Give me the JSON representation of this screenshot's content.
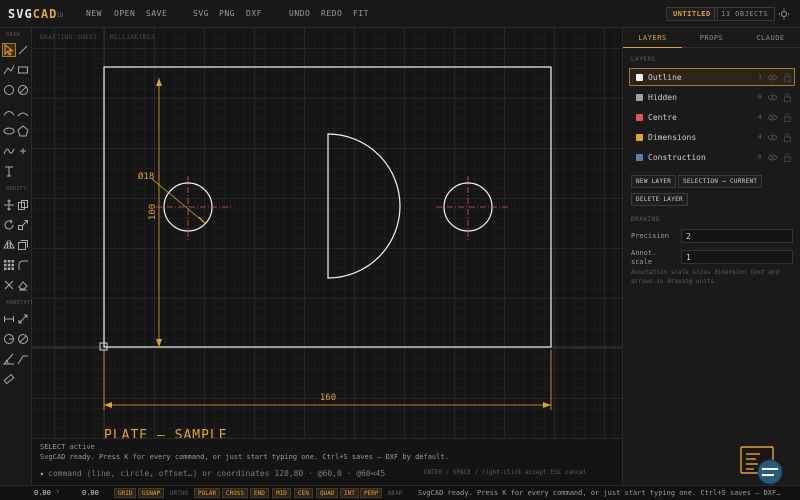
{
  "app": {
    "logo_main": "SVG",
    "logo_accent": "CAD",
    "logo_sub": "1D",
    "menu": [
      {
        "label": "NEW"
      },
      {
        "label": "OPEN"
      },
      {
        "label": "SAVE"
      },
      {
        "label": "SVG"
      },
      {
        "label": "PNG"
      },
      {
        "label": "DXF"
      },
      {
        "label": "UNDO"
      },
      {
        "label": "REDO"
      },
      {
        "label": "FIT"
      }
    ],
    "doc_name": "UNTITLED",
    "object_count": "13 OBJECTS"
  },
  "tools": {
    "sections": {
      "draw": "DRAW",
      "modify": "MODIFY",
      "annotate": "ANNOTATE"
    }
  },
  "canvas": {
    "label": "DRAFTING SHEET · MILLIMETRES",
    "dim_diameter": "Ø18",
    "dim_height": "100",
    "dim_width": "160",
    "title_text": "PLATE — SAMPLE"
  },
  "panel": {
    "tabs": [
      {
        "label": "LAYERS"
      },
      {
        "label": "PROPS"
      },
      {
        "label": "CLAUDE"
      }
    ],
    "layers_label": "LAYERS",
    "layers": [
      {
        "name": "Outline",
        "count": "3",
        "color": "#f2f2f2"
      },
      {
        "name": "Hidden",
        "count": "0",
        "color": "#9aa3ad"
      },
      {
        "name": "Centre",
        "count": "4",
        "color": "#e0575a"
      },
      {
        "name": "Dimensions",
        "count": "4",
        "color": "#e0a33a"
      },
      {
        "name": "Construction",
        "count": "0",
        "color": "#5e7f9e"
      }
    ],
    "buttons": {
      "new_layer": "NEW LAYER",
      "sel_current": "SELECTION → CURRENT",
      "delete_layer": "DELETE LAYER"
    },
    "drawing_label": "DRAWING",
    "precision_label": "Precision",
    "precision_value": "2",
    "annot_label_1": "Annot.",
    "annot_label_2": "scale",
    "annot_value": "1",
    "hint": "Annotation scale sizes dimension text and arrows in drawing units."
  },
  "console": {
    "line1": "SELECT active",
    "line2": "SvgCAD ready. Press K for every command, or just start typing one. Ctrl+S saves — DXF by default.",
    "prompt": "▸",
    "placeholder": "command (line, circle, offset…) or coordinates 120,80 · @60,0 · @60<45",
    "hints": "ENTER / SPACE / right-click accept   ESC cancel"
  },
  "status": {
    "x_value": "0.00",
    "x_label": "Y",
    "y_value": "0.00",
    "snaps": [
      {
        "label": "GRID",
        "on": true
      },
      {
        "label": "GSNAP",
        "on": true
      },
      {
        "label": "ORTHO",
        "on": false
      },
      {
        "label": "POLAR",
        "on": true
      },
      {
        "label": "CROSS",
        "on": true
      },
      {
        "label": "END",
        "on": true
      },
      {
        "label": "MID",
        "on": true
      },
      {
        "label": "CEN",
        "on": true
      },
      {
        "label": "QUAD",
        "on": true
      },
      {
        "label": "INT",
        "on": true
      },
      {
        "label": "PERP",
        "on": true
      },
      {
        "label": "NEAR",
        "on": false
      }
    ],
    "message": "SvgCAD ready. Press K for every command, or just start typing one. Ctrl+S saves — DXF…"
  },
  "colors": {
    "accent": "#e0a33a",
    "centre": "#e0575a",
    "outline": "#f2f2f2"
  },
  "icons": {
    "theme": "sun-icon",
    "assistant": "assistant-icon"
  }
}
